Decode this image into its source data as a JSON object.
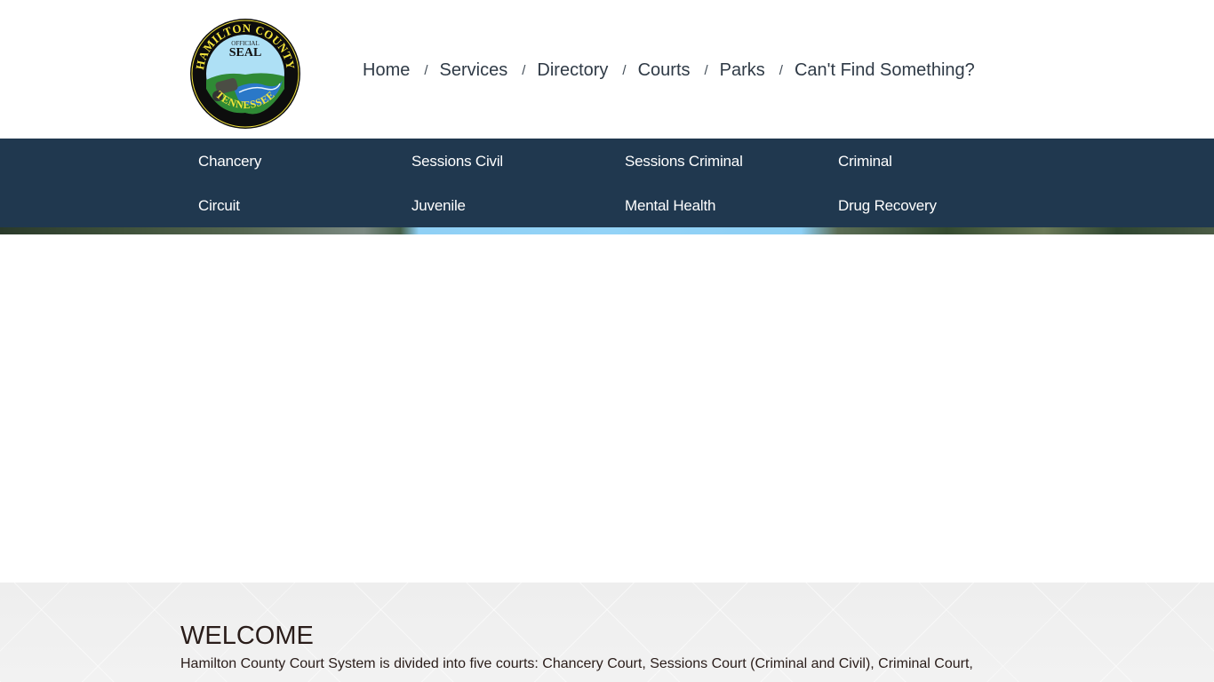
{
  "header": {
    "logo": {
      "alt": "Hamilton County Tennessee Official Seal",
      "top_text": "HAMILTON COUNTY",
      "bottom_text": "TENNESSEE",
      "center_small": "OFFICIAL",
      "center_large": "SEAL"
    },
    "top_nav": {
      "separator": "/",
      "items": [
        {
          "label": "Home"
        },
        {
          "label": "Services"
        },
        {
          "label": "Directory"
        },
        {
          "label": "Courts"
        },
        {
          "label": "Parks"
        },
        {
          "label": "Can't Find Something?"
        }
      ]
    }
  },
  "court_nav": {
    "items": [
      {
        "label": "Chancery"
      },
      {
        "label": "Sessions Civil"
      },
      {
        "label": "Sessions Criminal"
      },
      {
        "label": "Criminal"
      },
      {
        "label": "Circuit"
      },
      {
        "label": "Juvenile"
      },
      {
        "label": "Mental Health"
      },
      {
        "label": "Drug Recovery"
      }
    ]
  },
  "welcome": {
    "title": "WELCOME",
    "text": "Hamilton County Court System is divided into five courts: Chancery Court, Sessions Court (Criminal and Civil), Criminal Court,"
  },
  "colors": {
    "nav_bg": "#20384f",
    "nav_text": "#ffffff",
    "top_nav_text": "#2f3a46",
    "welcome_bg": "#efefef",
    "welcome_text": "#2a1d1a"
  }
}
